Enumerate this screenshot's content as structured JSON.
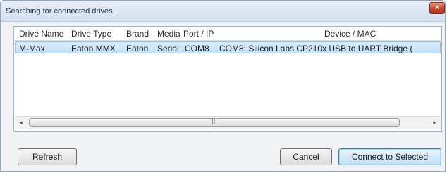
{
  "window": {
    "title": "Searching for connected drives.",
    "close_glyph": "×"
  },
  "list": {
    "columns": [
      "Drive Name",
      "Drive Type",
      "Brand",
      "Media",
      "Port / IP",
      "Device / MAC"
    ],
    "rows": [
      [
        "M-Max",
        "Eaton MMX",
        "Eaton",
        "Serial",
        "COM8",
        "COM8: Silicon Labs CP210x USB to UART Bridge ("
      ]
    ]
  },
  "scrollbar": {
    "left_arrow": "◂",
    "right_arrow": "▸",
    "grip": "|||"
  },
  "buttons": {
    "refresh": "Refresh",
    "cancel": "Cancel",
    "connect": "Connect to Selected"
  }
}
